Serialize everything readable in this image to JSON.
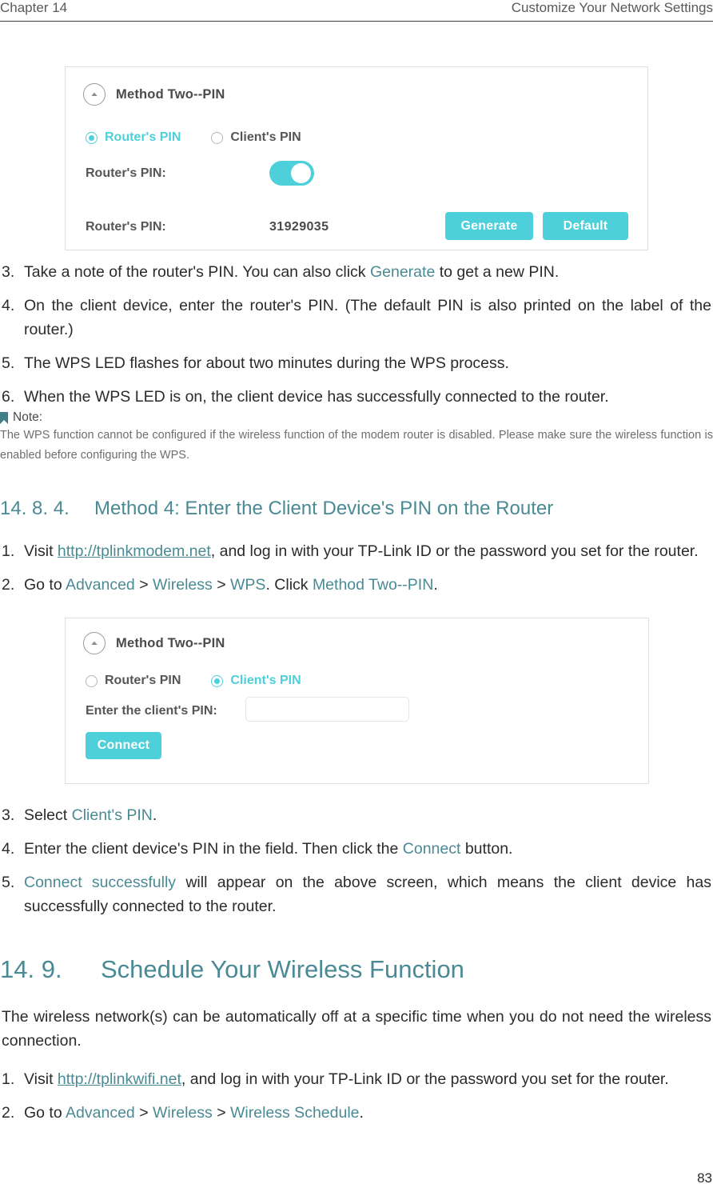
{
  "header": {
    "chapter": "Chapter 14",
    "title": "Customize Your Network Settings"
  },
  "panel_one": {
    "name": "wps-method-two-pin-router-pin-panel",
    "collapse_icon": "chevron-up-circle-icon",
    "title": "Method Two--PIN",
    "radios": [
      {
        "label": "Router's PIN",
        "selected": true
      },
      {
        "label": "Client's PIN",
        "selected": false
      }
    ],
    "toggle_label": "Router's PIN:",
    "toggle_state": "on",
    "pin_label": "Router's PIN:",
    "pin_value": "31929035",
    "buttons": [
      {
        "label": "Generate"
      },
      {
        "label": "Default"
      }
    ]
  },
  "steps_group_one": [
    {
      "num": "3.",
      "parts": [
        {
          "t": "Take a note of the router's PIN. You can also click ",
          "s": "plain"
        },
        {
          "t": "Generate",
          "s": "hl"
        },
        {
          "t": " to get a new PIN.",
          "s": "plain"
        }
      ]
    },
    {
      "num": "4.",
      "parts": [
        {
          "t": "On the client device, enter the router's PIN. (The default PIN is also printed on the label of the router.)",
          "s": "plain"
        }
      ]
    },
    {
      "num": "5.",
      "parts": [
        {
          "t": "The WPS LED flashes for about two minutes during the WPS process.",
          "s": "plain"
        }
      ]
    },
    {
      "num": "6.",
      "parts": [
        {
          "t": "When the WPS LED is on, the client device has successfully connected to the router.",
          "s": "plain"
        }
      ]
    }
  ],
  "note": {
    "icon": "note-bookmark-icon",
    "title": "Note:",
    "body": "The WPS function cannot be configured if the wireless function of the modem router is disabled. Please make sure the wireless function is enabled before configuring the WPS."
  },
  "heading_1484": {
    "number": "14. 8. 4.",
    "text": "Method 4: Enter the Client Device's PIN on the Router"
  },
  "steps_group_two": [
    {
      "num": "1.",
      "parts": [
        {
          "t": "Visit ",
          "s": "plain"
        },
        {
          "t": "http://tplinkmodem.net",
          "s": "lnk"
        },
        {
          "t": ", and log in with your TP-Link ID or the password you set for the router.",
          "s": "plain"
        }
      ]
    },
    {
      "num": "2.",
      "parts": [
        {
          "t": "Go to ",
          "s": "plain"
        },
        {
          "t": "Advanced",
          "s": "hl"
        },
        {
          "t": " > ",
          "s": "plain"
        },
        {
          "t": "Wireless",
          "s": "hl"
        },
        {
          "t": " > ",
          "s": "plain"
        },
        {
          "t": "WPS",
          "s": "hl"
        },
        {
          "t": ". Click ",
          "s": "plain"
        },
        {
          "t": "Method Two--PIN",
          "s": "hl"
        },
        {
          "t": ".",
          "s": "plain"
        }
      ]
    }
  ],
  "panel_two": {
    "name": "wps-method-two-pin-client-pin-panel",
    "collapse_icon": "chevron-up-circle-icon",
    "title": "Method Two--PIN",
    "radios": [
      {
        "label": "Router's PIN",
        "selected": false
      },
      {
        "label": "Client's PIN",
        "selected": true
      }
    ],
    "input_label": "Enter the client's PIN:",
    "input_value": "",
    "input_placeholder": "",
    "button_label": "Connect"
  },
  "steps_group_three": [
    {
      "num": "3.",
      "parts": [
        {
          "t": "Select ",
          "s": "plain"
        },
        {
          "t": "Client's PIN",
          "s": "hl"
        },
        {
          "t": ".",
          "s": "plain"
        }
      ]
    },
    {
      "num": "4.",
      "parts": [
        {
          "t": "Enter the client device's PIN in the field. Then click the ",
          "s": "plain"
        },
        {
          "t": "Connect",
          "s": "hl"
        },
        {
          "t": " button.",
          "s": "plain"
        }
      ]
    },
    {
      "num": "5.",
      "parts": [
        {
          "t": "Connect successfully",
          "s": "hl"
        },
        {
          "t": " will appear on the above screen, which means the client device has successfully connected to the router.",
          "s": "plain"
        }
      ]
    }
  ],
  "heading_149": {
    "number": "14. 9.",
    "text": "Schedule Your Wireless Function"
  },
  "intro_149": "The wireless network(s) can be automatically off at a specific time when you do not need the wireless connection.",
  "steps_group_four": [
    {
      "num": "1.",
      "parts": [
        {
          "t": "Visit ",
          "s": "plain"
        },
        {
          "t": "http://tplinkwifi.net",
          "s": "lnk"
        },
        {
          "t": ", and log in with your TP-Link ID or the password you set for the router.",
          "s": "plain"
        }
      ]
    },
    {
      "num": "2.",
      "parts": [
        {
          "t": "Go to ",
          "s": "plain"
        },
        {
          "t": "Advanced",
          "s": "hl"
        },
        {
          "t": " > ",
          "s": "plain"
        },
        {
          "t": "Wireless",
          "s": "hl"
        },
        {
          "t": " > ",
          "s": "plain"
        },
        {
          "t": "Wireless Schedule",
          "s": "hl"
        },
        {
          "t": ".",
          "s": "plain"
        }
      ]
    }
  ],
  "page_number": "83",
  "colors": {
    "accent_teal": "#4a8a94",
    "ui_cyan": "#4dd0da",
    "text": "#2b2b2b",
    "muted": "#6e6e6e"
  }
}
